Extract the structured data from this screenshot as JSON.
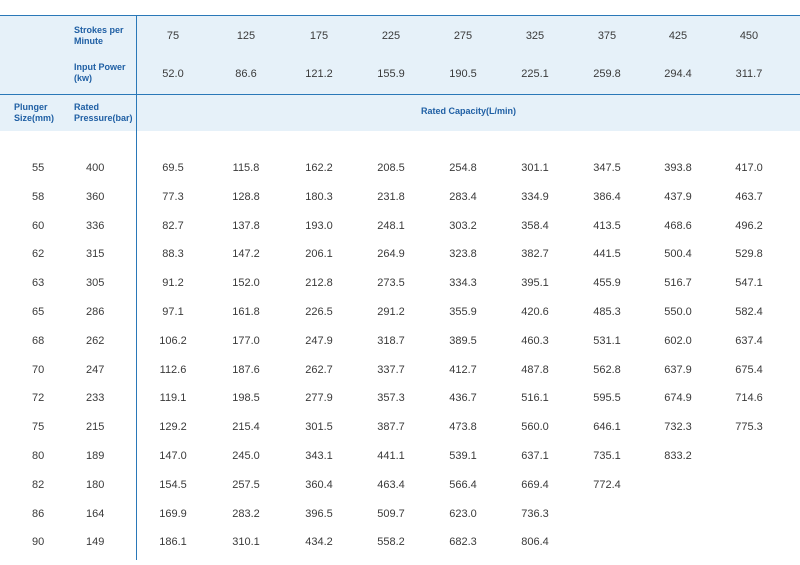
{
  "header": {
    "strokes_label": "Strokes per Minute",
    "power_label": "Input Power (kw)",
    "plunger_label": "Plunger Size(mm)",
    "pressure_label": "Rated Pressure(bar)",
    "capacity_label": "Rated Capacity(L/min)",
    "strokes": [
      "75",
      "125",
      "175",
      "225",
      "275",
      "325",
      "375",
      "425",
      "450"
    ],
    "power": [
      "52.0",
      "86.6",
      "121.2",
      "155.9",
      "190.5",
      "225.1",
      "259.8",
      "294.4",
      "311.7"
    ]
  },
  "rows": [
    {
      "size": "55",
      "pressure": "400",
      "caps": [
        "69.5",
        "115.8",
        "162.2",
        "208.5",
        "254.8",
        "301.1",
        "347.5",
        "393.8",
        "417.0"
      ]
    },
    {
      "size": "58",
      "pressure": "360",
      "caps": [
        "77.3",
        "128.8",
        "180.3",
        "231.8",
        "283.4",
        "334.9",
        "386.4",
        "437.9",
        "463.7"
      ]
    },
    {
      "size": "60",
      "pressure": "336",
      "caps": [
        "82.7",
        "137.8",
        "193.0",
        "248.1",
        "303.2",
        "358.4",
        "413.5",
        "468.6",
        "496.2"
      ]
    },
    {
      "size": "62",
      "pressure": "315",
      "caps": [
        "88.3",
        "147.2",
        "206.1",
        "264.9",
        "323.8",
        "382.7",
        "441.5",
        "500.4",
        "529.8"
      ]
    },
    {
      "size": "63",
      "pressure": "305",
      "caps": [
        "91.2",
        "152.0",
        "212.8",
        "273.5",
        "334.3",
        "395.1",
        "455.9",
        "516.7",
        "547.1"
      ]
    },
    {
      "size": "65",
      "pressure": "286",
      "caps": [
        "97.1",
        "161.8",
        "226.5",
        "291.2",
        "355.9",
        "420.6",
        "485.3",
        "550.0",
        "582.4"
      ]
    },
    {
      "size": "68",
      "pressure": "262",
      "caps": [
        "106.2",
        "177.0",
        "247.9",
        "318.7",
        "389.5",
        "460.3",
        "531.1",
        "602.0",
        "637.4"
      ]
    },
    {
      "size": "70",
      "pressure": "247",
      "caps": [
        "112.6",
        "187.6",
        "262.7",
        "337.7",
        "412.7",
        "487.8",
        "562.8",
        "637.9",
        "675.4"
      ]
    },
    {
      "size": "72",
      "pressure": "233",
      "caps": [
        "119.1",
        "198.5",
        "277.9",
        "357.3",
        "436.7",
        "516.1",
        "595.5",
        "674.9",
        "714.6"
      ]
    },
    {
      "size": "75",
      "pressure": "215",
      "caps": [
        "129.2",
        "215.4",
        "301.5",
        "387.7",
        "473.8",
        "560.0",
        "646.1",
        "732.3",
        "775.3"
      ]
    },
    {
      "size": "80",
      "pressure": "189",
      "caps": [
        "147.0",
        "245.0",
        "343.1",
        "441.1",
        "539.1",
        "637.1",
        "735.1",
        "833.2",
        ""
      ]
    },
    {
      "size": "82",
      "pressure": "180",
      "caps": [
        "154.5",
        "257.5",
        "360.4",
        "463.4",
        "566.4",
        "669.4",
        "772.4",
        "",
        ""
      ]
    },
    {
      "size": "86",
      "pressure": "164",
      "caps": [
        "169.9",
        "283.2",
        "396.5",
        "509.7",
        "623.0",
        "736.3",
        "",
        "",
        ""
      ]
    },
    {
      "size": "90",
      "pressure": "149",
      "caps": [
        "186.1",
        "310.1",
        "434.2",
        "558.2",
        "682.3",
        "806.4",
        "",
        "",
        ""
      ]
    }
  ]
}
